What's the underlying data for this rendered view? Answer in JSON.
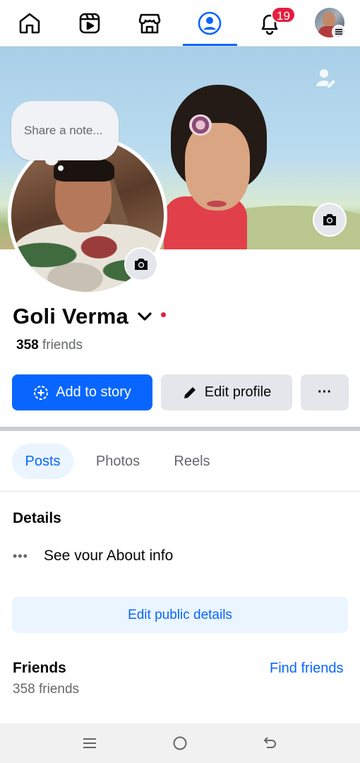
{
  "nav": {
    "notification_count": "19",
    "active_tab": "profile",
    "icons": [
      "home-icon",
      "video-icon",
      "marketplace-icon",
      "profile-icon",
      "bell-icon",
      "avatar"
    ]
  },
  "note": {
    "placeholder": "Share a note..."
  },
  "profile": {
    "name": "Goli Verma",
    "friends_number": "358",
    "friends_label": "friends"
  },
  "actions": {
    "add_story": "Add to story",
    "edit_profile": "Edit profile",
    "more": "···"
  },
  "tabs": {
    "posts": "Posts",
    "photos": "Photos",
    "reels": "Reels"
  },
  "details": {
    "title": "Details",
    "about_text": "See vour About info",
    "edit_public": "Edit public details"
  },
  "friends": {
    "title": "Friends",
    "find_friends": "Find friends",
    "count_text": "358 friends"
  },
  "colors": {
    "accent": "#0866ff",
    "badge": "#e41e3f",
    "secondary_button": "#e4e6eb",
    "light_accent": "#ebf5ff"
  }
}
